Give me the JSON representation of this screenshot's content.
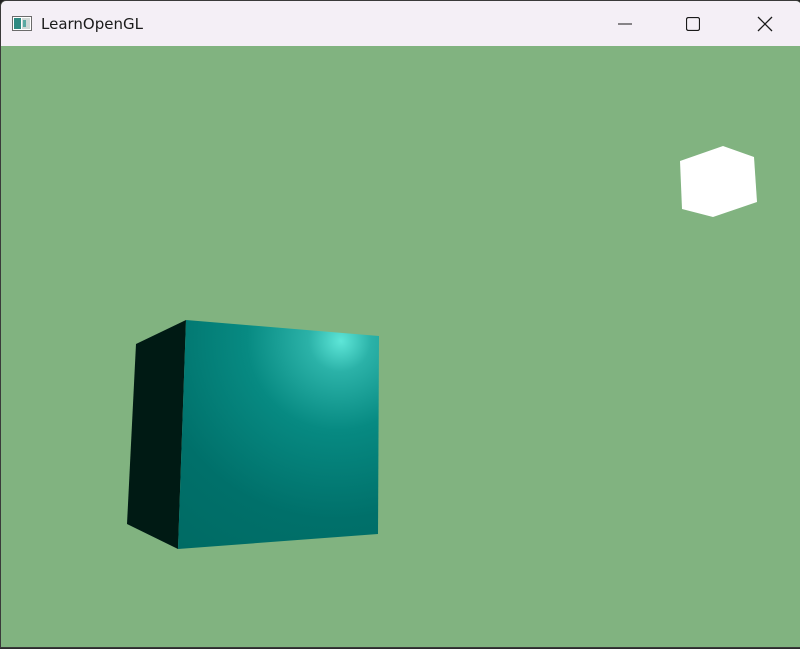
{
  "window": {
    "title": "LearnOpenGL"
  },
  "colors": {
    "clear_color": "#81b380",
    "titlebar_bg": "#f4eff6",
    "cube_front": "#00706a",
    "cube_highlight": "#5ee6d8",
    "cube_side": "#001a14",
    "light_cube": "#ffffff"
  },
  "icons": {
    "app": "window-app-icon",
    "minimize": "minimize-icon",
    "maximize": "maximize-icon",
    "close": "close-icon"
  }
}
